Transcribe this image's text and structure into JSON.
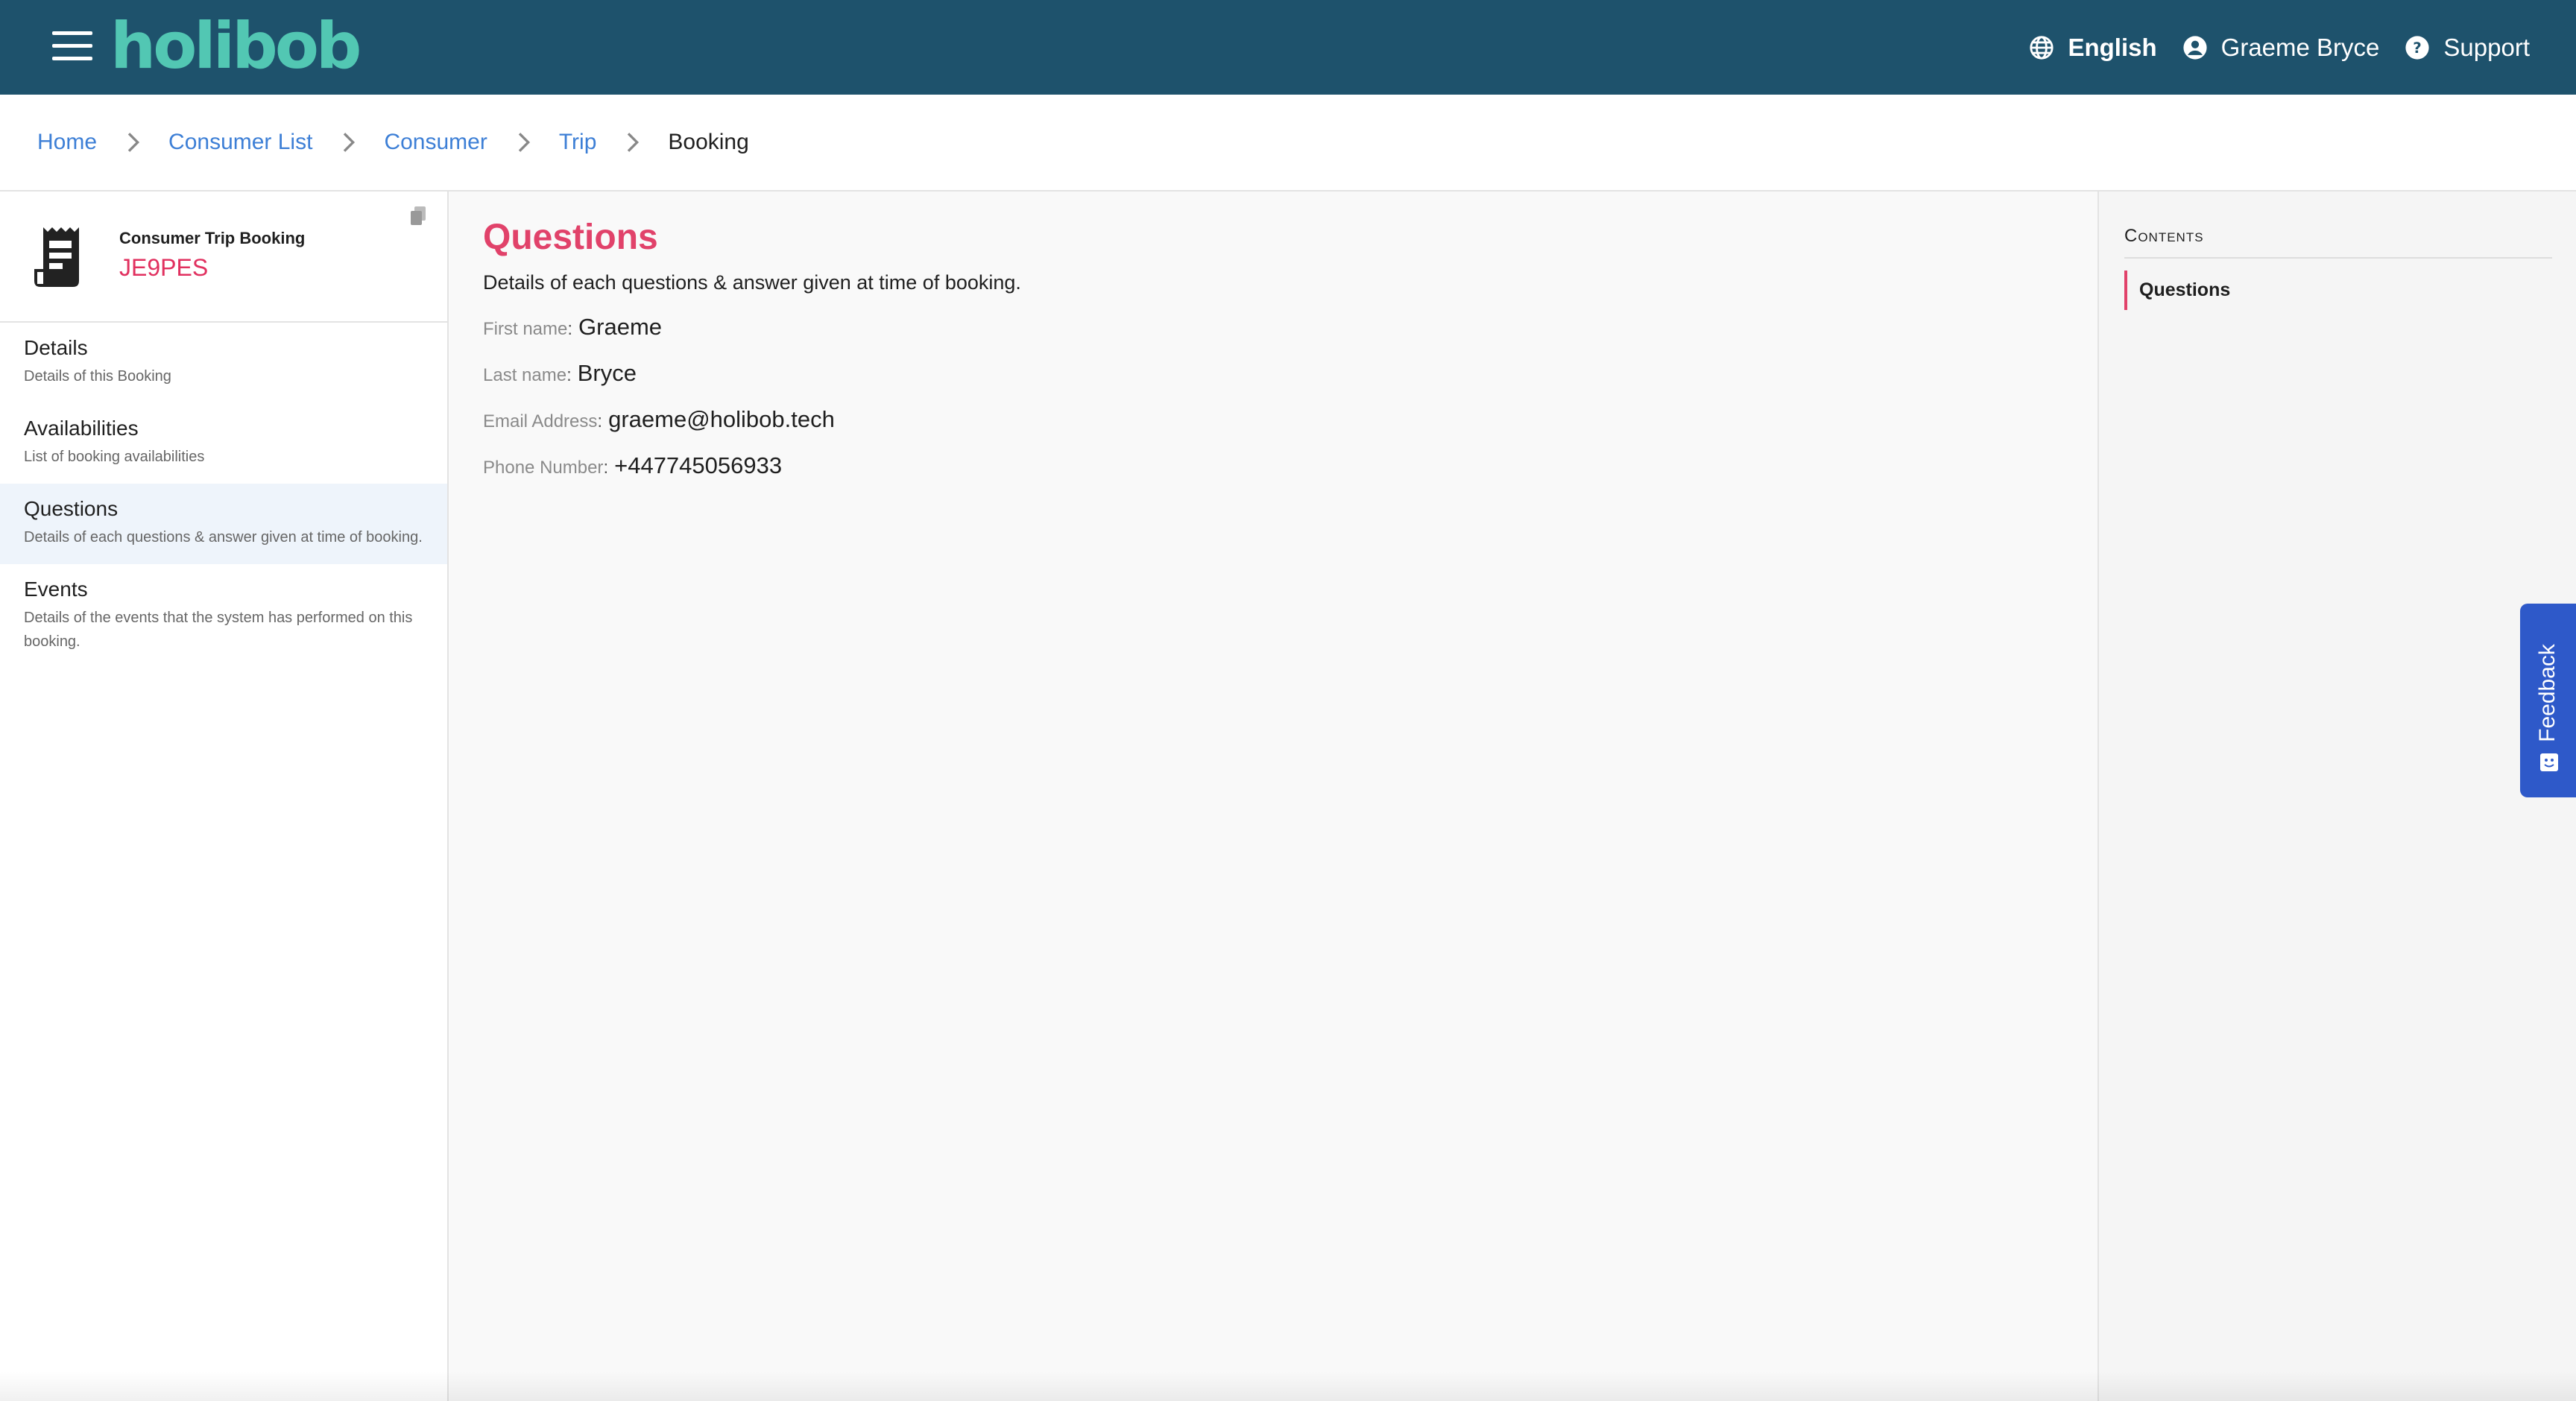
{
  "header": {
    "logo_text": "holibob",
    "menu_icon": "hamburger-menu-icon",
    "language_label": "English",
    "user_name": "Graeme Bryce",
    "support_label": "Support",
    "colors": {
      "bar": "#1e526c",
      "logo": "#52c7b3"
    }
  },
  "breadcrumb": {
    "items": [
      "Home",
      "Consumer List",
      "Consumer",
      "Trip"
    ],
    "current": "Booking"
  },
  "sidebar": {
    "card_title": "Consumer Trip Booking",
    "card_ref": "JE9PES",
    "items": [
      {
        "title": "Details",
        "desc": "Details of this Booking"
      },
      {
        "title": "Availabilities",
        "desc": "List of booking availabilities"
      },
      {
        "title": "Questions",
        "desc": "Details of each questions & answer given at time of booking."
      },
      {
        "title": "Events",
        "desc": "Details of the events that the system has performed on this booking."
      }
    ]
  },
  "main": {
    "title": "Questions",
    "subtitle": "Details of each questions & answer given at time of booking.",
    "questions": [
      {
        "label": "First name",
        "value": "Graeme"
      },
      {
        "label": "Last name",
        "value": "Bryce"
      },
      {
        "label": "Email Address",
        "value": "graeme@holibob.tech"
      },
      {
        "label": "Phone Number",
        "value": "+447745056933"
      }
    ],
    "accent_color": "#e1426a"
  },
  "contents": {
    "title": "Contents",
    "items": [
      "Questions"
    ]
  },
  "feedback": {
    "label": "Feedback",
    "color": "#2e59c9"
  }
}
